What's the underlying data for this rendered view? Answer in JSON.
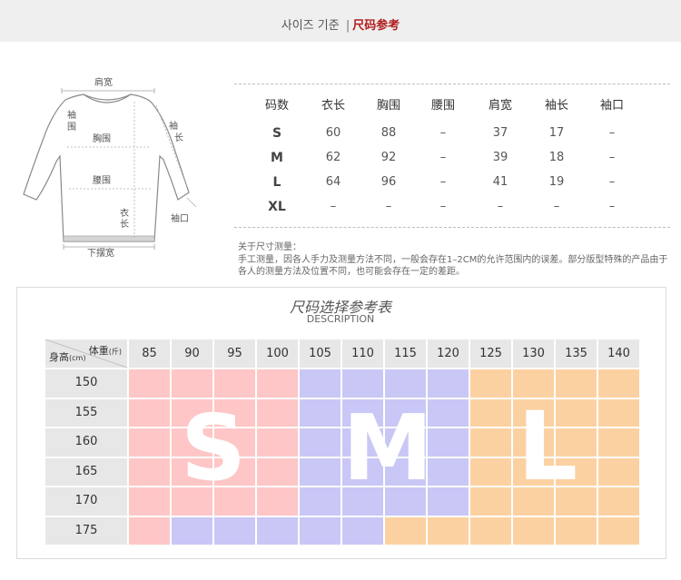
{
  "header": {
    "korean": "사이즈 기준",
    "separator": "|",
    "chinese": "尺码参考"
  },
  "diagram": {
    "shoulder": "肩宽",
    "sleeve_opening_top": "袖",
    "sleeve_opening_bottom": "围",
    "sleeve_length_top": "袖",
    "sleeve_length_bottom": "长",
    "chest": "胸围",
    "waist": "腰围",
    "length_top": "衣",
    "length_bottom": "长",
    "cuff": "袖口",
    "hem": "下摆宽"
  },
  "size_table": {
    "headers": [
      "码数",
      "衣长",
      "胸围",
      "腰围",
      "肩宽",
      "袖长",
      "袖口"
    ],
    "rows": [
      {
        "size": "S",
        "values": [
          "60",
          "88",
          "–",
          "37",
          "17",
          "–"
        ]
      },
      {
        "size": "M",
        "values": [
          "62",
          "92",
          "–",
          "39",
          "18",
          "–"
        ]
      },
      {
        "size": "L",
        "values": [
          "64",
          "96",
          "–",
          "41",
          "19",
          "–"
        ]
      },
      {
        "size": "XL",
        "values": [
          "–",
          "–",
          "–",
          "–",
          "–",
          "–"
        ]
      }
    ]
  },
  "note": {
    "title": "关于尺寸测量：",
    "body": "手工测量，因各人手力及测量方法不同，一般会存在1–2CM的允许范围内的误差。部分版型特殊的产品由于各人的测量方法及位置不同，也可能会存在一定的差距。"
  },
  "reference": {
    "title": "尺码选择参考表",
    "subtitle": "DESCRIPTION",
    "weight_label": "体重",
    "weight_unit": "(斤)",
    "height_label": "身高",
    "height_unit": "(cm)",
    "weights": [
      "85",
      "90",
      "95",
      "100",
      "105",
      "110",
      "115",
      "120",
      "125",
      "130",
      "135",
      "140"
    ],
    "heights": [
      "150",
      "155",
      "160",
      "165",
      "170",
      "175"
    ],
    "grid": [
      [
        "S",
        "S",
        "S",
        "S",
        "M",
        "M",
        "M",
        "M",
        "L",
        "L",
        "L",
        "L"
      ],
      [
        "S",
        "S",
        "S",
        "S",
        "M",
        "M",
        "M",
        "M",
        "L",
        "L",
        "L",
        "L"
      ],
      [
        "S",
        "S",
        "S",
        "S",
        "M",
        "M",
        "M",
        "M",
        "L",
        "L",
        "L",
        "L"
      ],
      [
        "S",
        "S",
        "S",
        "S",
        "M",
        "M",
        "M",
        "M",
        "L",
        "L",
        "L",
        "L"
      ],
      [
        "S",
        "S",
        "S",
        "S",
        "M",
        "M",
        "M",
        "M",
        "L",
        "L",
        "L",
        "L"
      ],
      [
        "S",
        "M",
        "M",
        "M",
        "M",
        "M",
        "L",
        "L",
        "L",
        "L",
        "L",
        "L"
      ]
    ],
    "big_labels": {
      "S": "S",
      "M": "M",
      "L": "L"
    },
    "colors": {
      "S": "#fec6c6",
      "M": "#c9c7f5",
      "L": "#fcd1a2"
    }
  }
}
